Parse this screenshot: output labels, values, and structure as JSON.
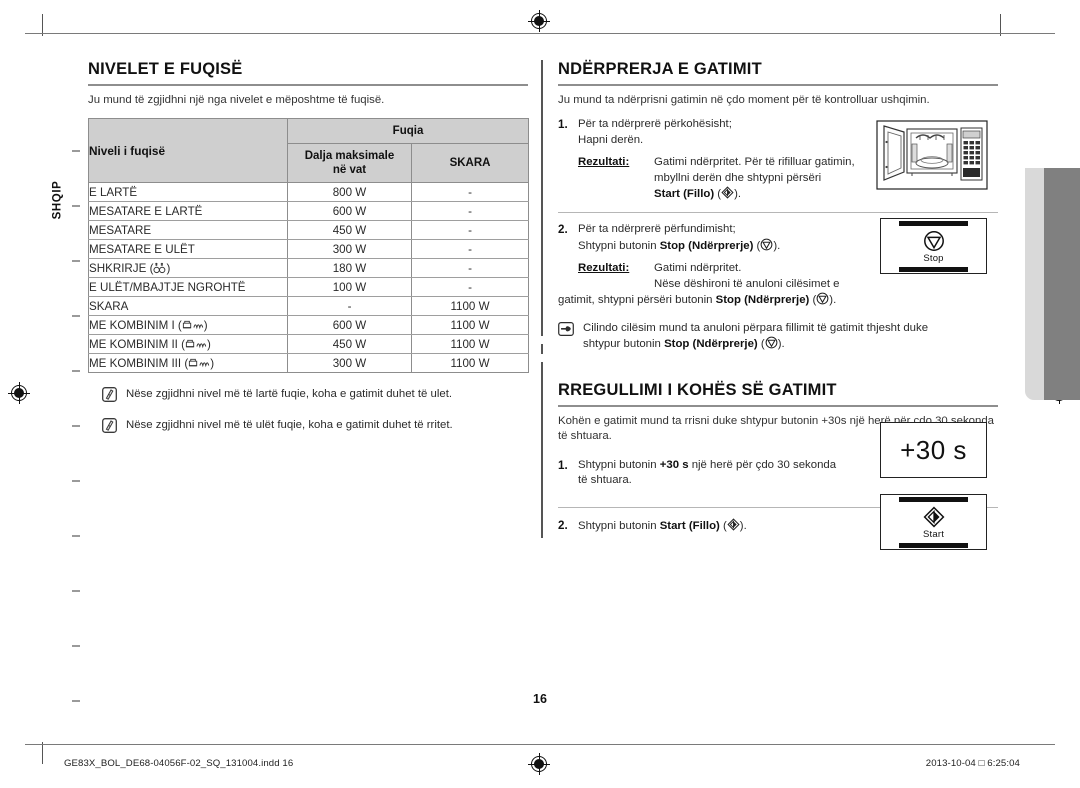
{
  "page": {
    "number": "16",
    "language_tab": "SHQIP"
  },
  "left": {
    "heading": "NIVELET E FUQISË",
    "intro": "Ju mund të zgjidhni një nga nivelet e mëposhtme të fuqisë.",
    "table": {
      "col_level_header": "Niveli i fuqisë",
      "group_header": "Fuqia",
      "col_output_header": "Dalja maksimale\nnë vat",
      "col_output_header_line1": "Dalja maksimale",
      "col_output_header_line2": "në vat",
      "col_grill_header": "SKARA",
      "rows": [
        {
          "level": "E LARTË",
          "icon": "",
          "output": "800 W",
          "grill": "-"
        },
        {
          "level": "MESATARE E LARTË",
          "icon": "",
          "output": "600 W",
          "grill": "-"
        },
        {
          "level": "MESATARE",
          "icon": "",
          "output": "450 W",
          "grill": "-"
        },
        {
          "level": "MESATARE E ULËT",
          "icon": "",
          "output": "300 W",
          "grill": "-"
        },
        {
          "level": "SHKRIRJE",
          "icon": "defrost",
          "output": "180 W",
          "grill": "-"
        },
        {
          "level": "E ULËT/MBAJTJE NGROHTË",
          "icon": "",
          "output": "100 W",
          "grill": "-"
        },
        {
          "level": "SKARA",
          "icon": "",
          "output": "-",
          "grill": "1100 W"
        },
        {
          "level": "ME KOMBINIM I",
          "icon": "combi",
          "output": "600 W",
          "grill": "1100 W"
        },
        {
          "level": "ME KOMBINIM II",
          "icon": "combi",
          "output": "450 W",
          "grill": "1100 W"
        },
        {
          "level": "ME KOMBINIM III",
          "icon": "combi",
          "output": "300 W",
          "grill": "1100 W"
        }
      ]
    },
    "notes": [
      "Nëse zgjidhni nivel më të lartë fuqie, koha e gatimit duhet të ulet.",
      "Nëse zgjidhni nivel më të ulët fuqie, koha e gatimit duhet të rritet."
    ]
  },
  "right": {
    "section1": {
      "heading": "NDËRPRERJA E GATIMIT",
      "intro": "Ju mund ta ndërprisni gatimin në çdo moment për të kontrolluar ushqimin.",
      "step1": {
        "num": "1.",
        "line1": "Për ta ndërprerë përkohësisht;",
        "line2": "Hapni derën.",
        "result_label": "Rezultati:",
        "result_line1": "Gatimi ndërpritet. Për të rifilluar gatimin,",
        "result_line2": "mbyllni derën dhe shtypni përsëri",
        "result_line3_bold": "Start (Fillo)",
        "result_line3_tail": " ( ).",
        "figure": "microwave-open-door"
      },
      "step2": {
        "num": "2.",
        "line1": "Për ta ndërprerë përfundimisht;",
        "line2_prefix": "Shtypni butonin ",
        "line2_bold": "Stop (Ndërprerje)",
        "line2_tail": " ( ).",
        "result_label": "Rezultati:",
        "result_line1": "Gatimi ndërpritet.",
        "result_line2": "Nëse dëshironi të anuloni cilësimet e",
        "result_line3_prefix": "gatimit, shtypni përsëri butonin ",
        "result_line3_bold": "Stop (Ndërprerje)",
        "result_line3_tail": " ( )."
      },
      "tip": {
        "line1": "Cilindo cilësim mund ta anuloni përpara fillimit të gatimit thjesht duke",
        "line2_prefix": "shtypur butonin ",
        "line2_bold": "Stop (Ndërprerje)",
        "line2_tail": " ( )."
      },
      "stop_key": {
        "label": "Stop",
        "glyph": "stop-octagon-icon"
      }
    },
    "section2": {
      "heading": "RREGULLIMI I KOHËS SË GATIMIT",
      "intro_line1": "Kohën e gatimit mund ta rrisni duke shtypur butonin +30s një herë për çdo 30",
      "intro_line2": "sekonda të shtuara.",
      "step1": {
        "num": "1.",
        "prefix": "Shtypni butonin ",
        "bold": "+30 s",
        "tail": " një herë për çdo 30 sekonda",
        "line2": "të shtuara."
      },
      "step2": {
        "num": "2.",
        "prefix": "Shtypni butonin ",
        "bold": "Start (Fillo)",
        "tail": " ( )."
      },
      "plus30_key": {
        "label": "+30 s"
      },
      "start_key": {
        "label": "Start",
        "glyph": "start-diamond-icon"
      }
    }
  },
  "footer": {
    "left": "GE83X_BOL_DE68-04056F-02_SQ_131004.indd   16",
    "right": "2013-10-04   □ 6:25:04"
  }
}
